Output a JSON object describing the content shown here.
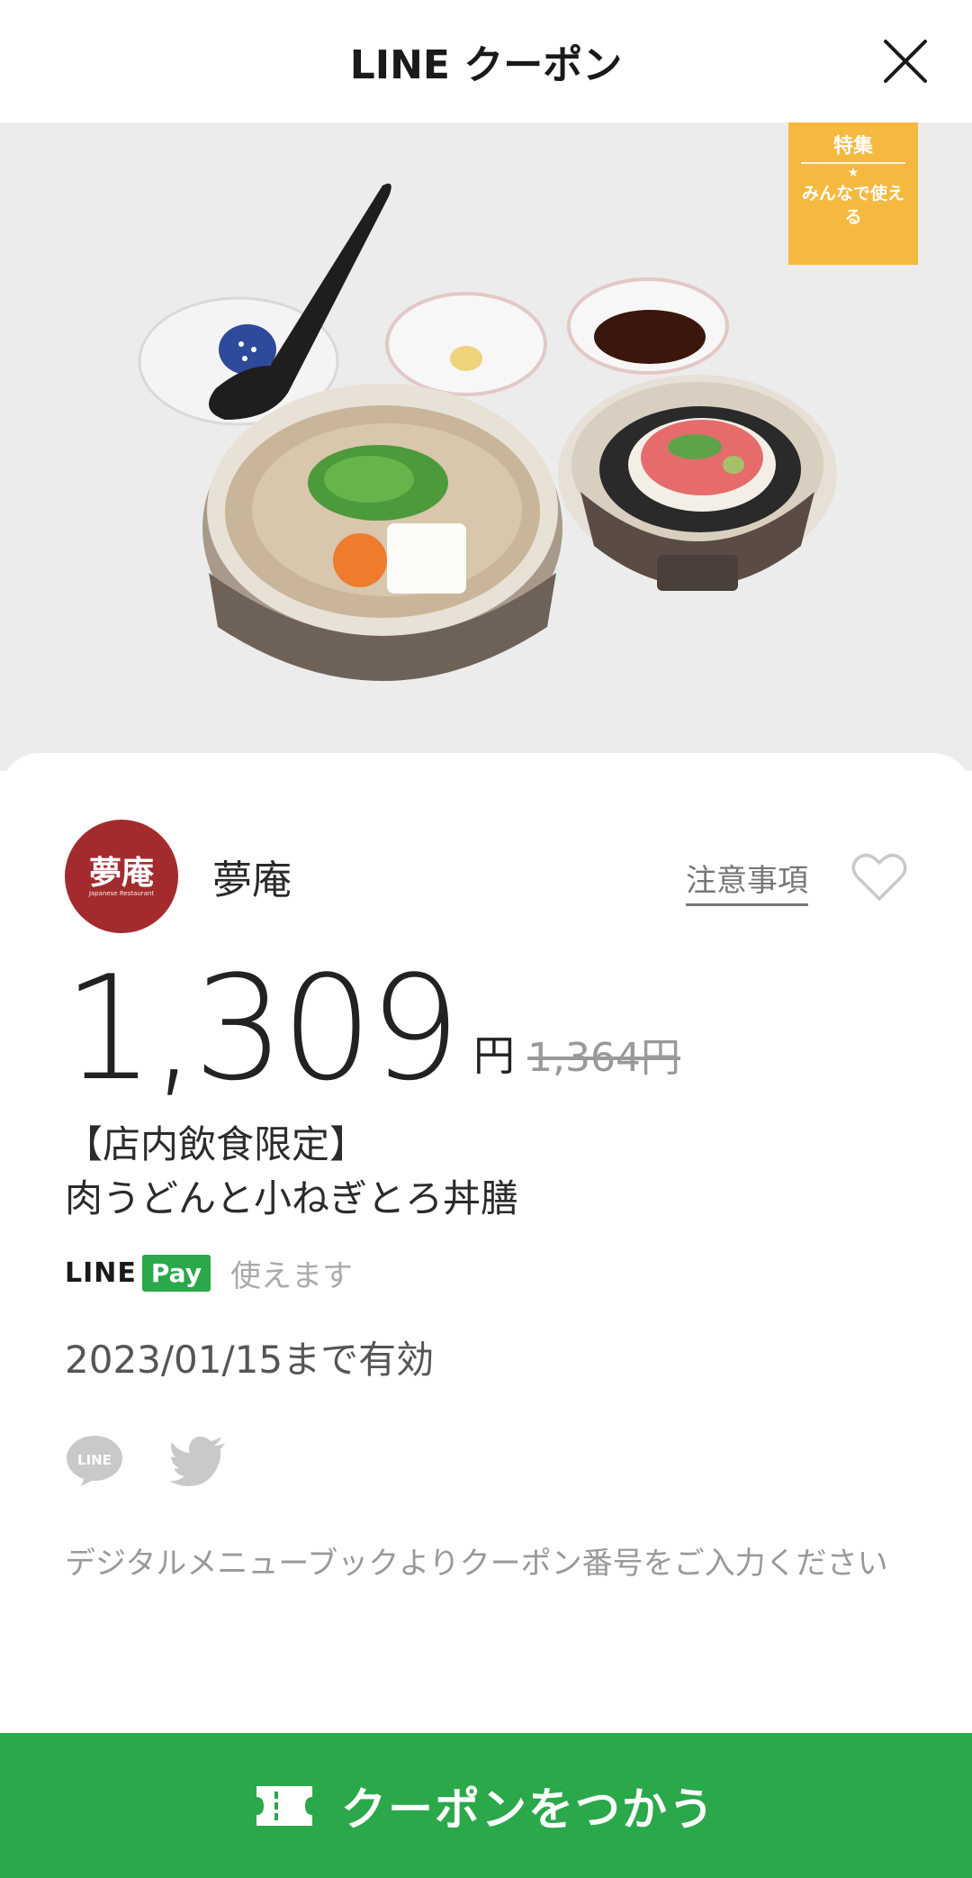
{
  "header": {
    "title": "LINE クーポン"
  },
  "badge": {
    "line1": "特集",
    "star": "★",
    "line2": "みんなで使える"
  },
  "store": {
    "logo_text": "夢庵",
    "logo_sub": "Japanese Restaurant",
    "name": "夢庵",
    "notes_label": "注意事項"
  },
  "price": {
    "value": "1,309",
    "unit": "円",
    "original": "1,364円"
  },
  "coupon": {
    "title_line1": "【店内飲食限定】",
    "title_line2": "肉うどんと小ねぎとろ丼膳"
  },
  "payment": {
    "line_text": "LINE",
    "pay_badge": "Pay",
    "status": "使えます"
  },
  "validity": "2023/01/15まで有効",
  "share": {
    "line_label": "LINE"
  },
  "instruction": "デジタルメニューブックよりクーポン番号をご入力ください",
  "cta": {
    "label": "クーポンをつかう"
  },
  "colors": {
    "accent_green": "#2aa84a",
    "badge_orange": "#f5b940",
    "logo_red": "#a42b2d"
  }
}
